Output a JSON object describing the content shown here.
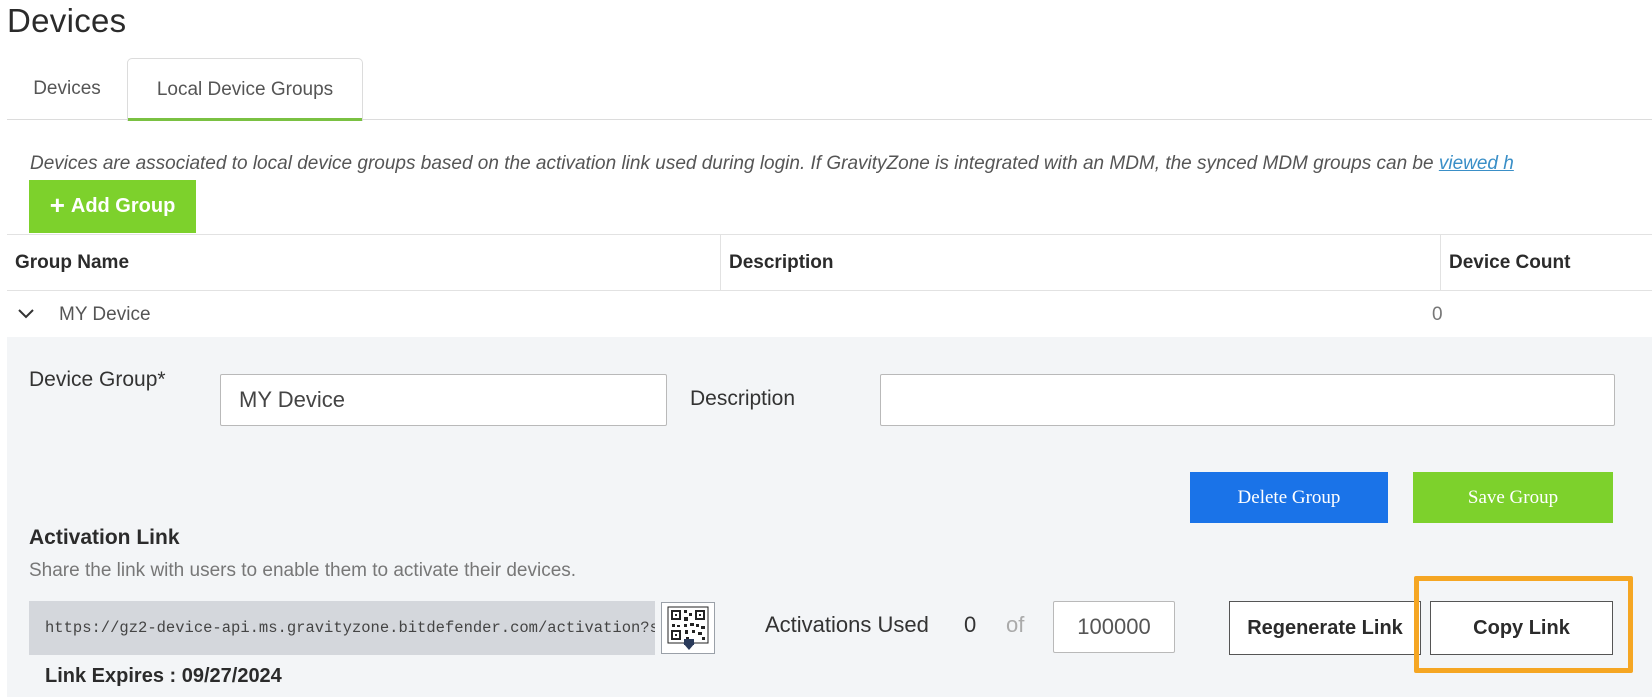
{
  "page": {
    "title": "Devices"
  },
  "tabs": [
    {
      "label": "Devices",
      "active": false
    },
    {
      "label": "Local Device Groups",
      "active": true
    }
  ],
  "info": {
    "text": "Devices are associated to local device groups based on the activation link used during login. If GravityZone is integrated with an MDM, the synced MDM groups can be ",
    "link_text": "viewed h"
  },
  "toolbar": {
    "add_group_label": "Add Group",
    "add_icon": "plus-icon"
  },
  "table": {
    "columns": [
      "Group Name",
      "Description",
      "Device Count"
    ],
    "rows": [
      {
        "name": "MY Device",
        "description": "",
        "device_count": "0",
        "expanded": true,
        "icon": "chevron-down-icon"
      }
    ]
  },
  "group_editor": {
    "device_group_label": "Device Group*",
    "device_group_value": "MY Device",
    "description_label": "Description",
    "description_value": "",
    "delete_label": "Delete Group",
    "save_label": "Save Group"
  },
  "activation": {
    "title": "Activation Link",
    "description": "Share the link with users to enable them to activate their devices.",
    "link": "https://gz2-device-api.ms.gravityzone.bitdefender.com/activation?st...",
    "qr_icon": "qr-code-download-icon",
    "used_label": "Activations Used",
    "used_count": "0",
    "of_label": "of",
    "max_value": "100000",
    "regenerate_label": "Regenerate Link",
    "copy_label": "Copy Link",
    "expires": "Link Expires : 09/27/2024"
  },
  "colors": {
    "accent_green": "#7dd12c",
    "tab_underline": "#7ac142",
    "delete_blue": "#1a73e8",
    "highlight_orange": "#f5a623",
    "link_blue": "#3a8fc7"
  }
}
